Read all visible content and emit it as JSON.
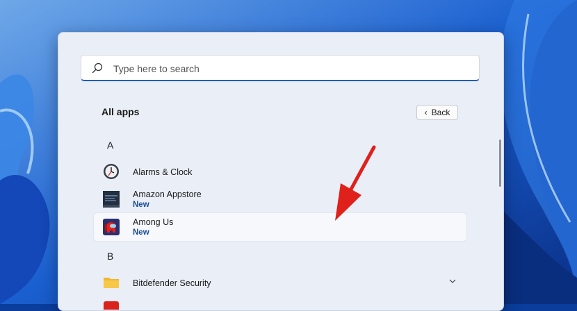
{
  "search": {
    "placeholder": "Type here to search"
  },
  "all_apps": {
    "title": "All apps",
    "back_label": "Back"
  },
  "sections": [
    {
      "letter": "A",
      "apps": [
        {
          "name": "Alarms & Clock",
          "badge": ""
        },
        {
          "name": "Amazon Appstore",
          "badge": "New"
        },
        {
          "name": "Among Us",
          "badge": "New"
        }
      ]
    },
    {
      "letter": "B",
      "apps": [
        {
          "name": "Bitdefender Security",
          "badge": ""
        }
      ]
    }
  ],
  "icons": {
    "search": "search-icon",
    "back": "chevron-left-icon",
    "expand": "chevron-down-icon",
    "alarms": "alarm-clock-icon",
    "amazon": "amazon-appstore-icon",
    "among_us": "among-us-icon",
    "folder": "folder-icon",
    "annotation": "red-arrow-annotation"
  },
  "colors": {
    "accent": "#1f5fb8",
    "badge": "#1a4d95",
    "annotation": "#e0201a"
  }
}
